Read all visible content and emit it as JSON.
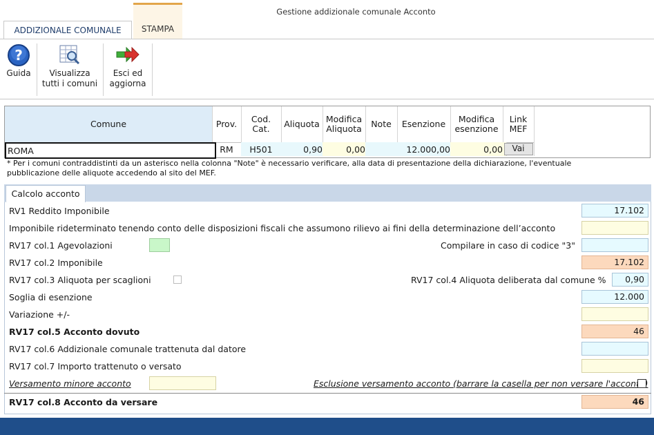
{
  "window": {
    "title": "Gestione addizionale comunale Acconto"
  },
  "ribbon_tabs": [
    {
      "label": "ADDIZIONALE COMUNALE",
      "active": true
    },
    {
      "label": "STAMPA",
      "active": false
    }
  ],
  "toolbar": {
    "guida": "Guida",
    "visualizza_l1": "Visualizza",
    "visualizza_l2": "tutti i comuni",
    "esci_l1": "Esci ed",
    "esci_l2": "aggiorna"
  },
  "grid": {
    "headers": {
      "comune": "Comune",
      "prov": "Prov.",
      "cod_cat_l1": "Cod.",
      "cod_cat_l2": "Cat.",
      "aliquota": "Aliquota",
      "mod_aliq_l1": "Modifica",
      "mod_aliq_l2": "Aliquota",
      "note": "Note",
      "esenzione": "Esenzione",
      "mod_esen_l1": "Modifica",
      "mod_esen_l2": "esenzione",
      "link_l1": "Link",
      "link_l2": "MEF"
    },
    "row": {
      "comune": "ROMA",
      "prov": "RM",
      "cod_cat": "H501",
      "aliquota": "0,90",
      "mod_aliquota": "0,00",
      "note": "",
      "esenzione": "12.000,00",
      "mod_esenzione": "0,00",
      "link": "Vai"
    }
  },
  "note": {
    "line1": "* Per i comuni contraddistinti da un asterisco nella colonna \"Note\" è necessario verificare,  alla data di presentazione della dichiarazione, l'eventuale",
    "line2": "pubblicazione delle aliquote accedendo al sito del MEF."
  },
  "calc": {
    "tab": "Calcolo acconto",
    "rv1_label": "RV1 Reddito Imponibile",
    "rv1_value": "17.102",
    "imponibile_rid_label": "Imponibile rideterminato tenendo conto delle disposizioni fiscali che assumono rilievo ai fini della determinazione dell’acconto",
    "imponibile_rid_value": "",
    "col1_label": "RV17 col.1 Agevolazioni",
    "col1_value": "",
    "codice3_label": "Compilare in caso di codice \"3\"",
    "codice3_value": "",
    "col2_label": "RV17 col.2 Imponibile",
    "col2_value": "17.102",
    "col3_label": "RV17 col.3 Aliquota per scaglioni",
    "col4_label": "RV17 col.4 Aliquota deliberata dal comune %",
    "col4_value": "0,90",
    "soglia_label": "Soglia di esenzione",
    "soglia_value": "12.000",
    "variazione_label": "Variazione +/-",
    "variazione_value": "",
    "col5_label": "RV17 col.5 Acconto dovuto",
    "col5_value": "46",
    "col6_label": "RV17 col.6 Addizionale comunale trattenuta dal datore",
    "col6_value": "",
    "col7_label": "RV17 col.7 Importo trattenuto o versato",
    "col7_value": "",
    "versamento_label": "Versamento minore acconto",
    "versamento_value": "",
    "esclusione_label": "Esclusione versamento acconto (barrare la casella per non versare l'acconto)",
    "col8_label": "RV17 col.8 Acconto da versare",
    "col8_value": "46"
  }
}
